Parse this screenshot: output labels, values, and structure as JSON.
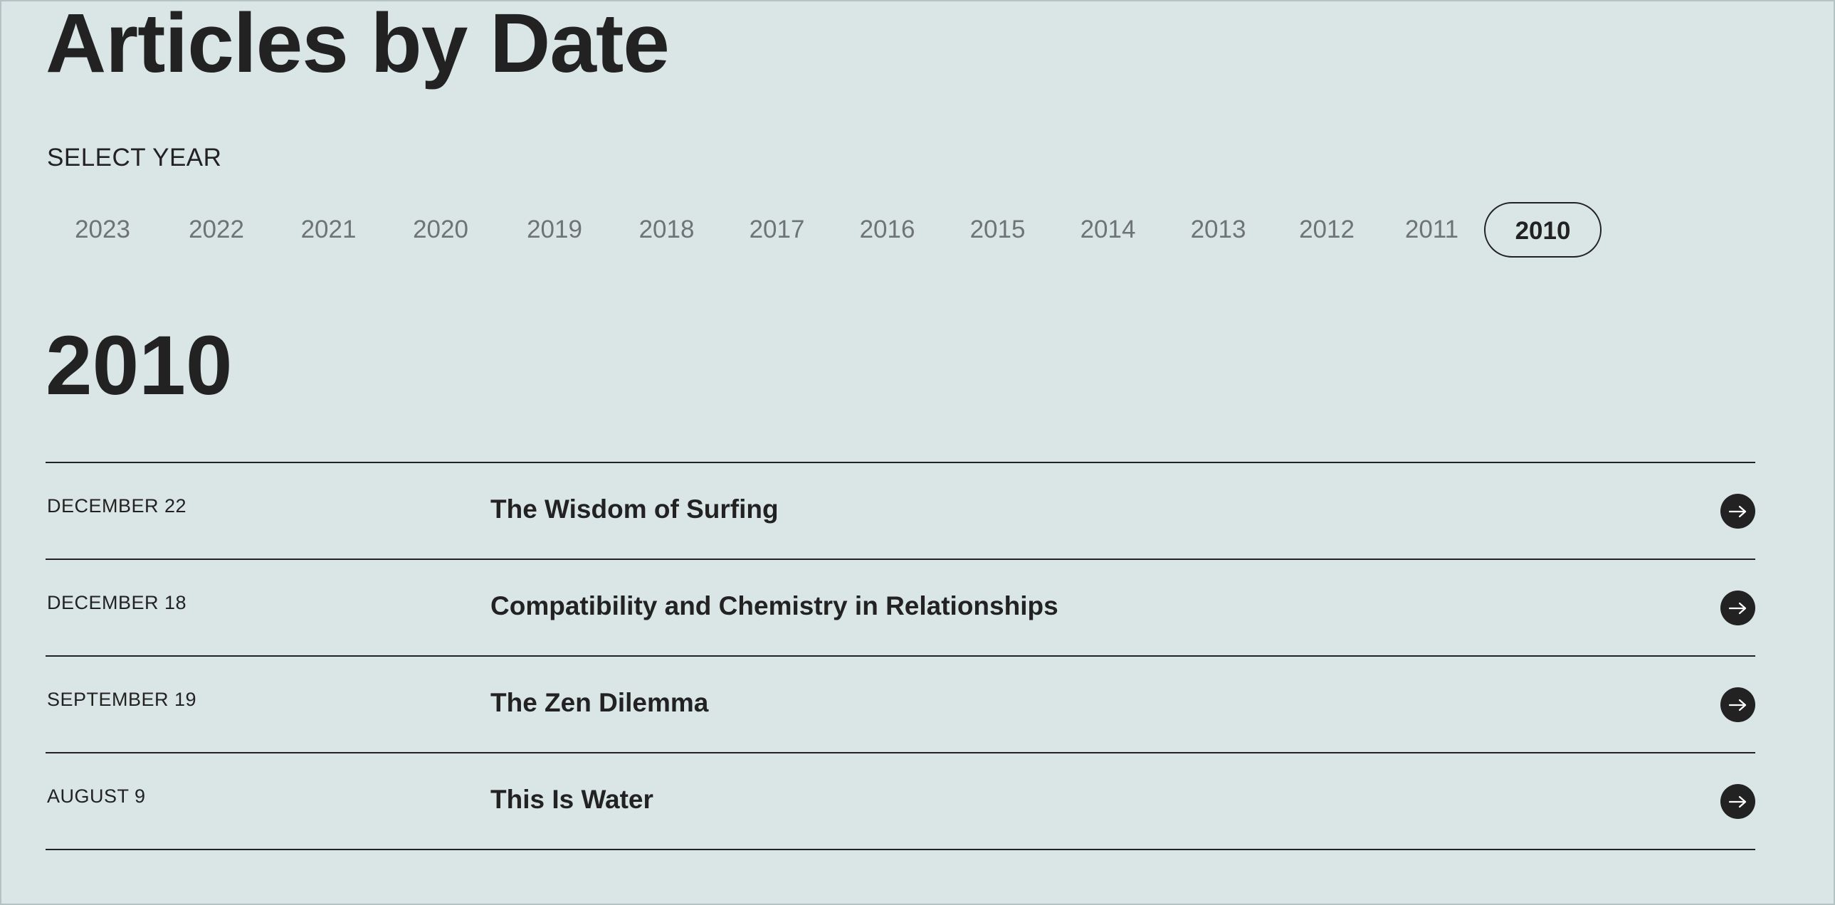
{
  "page": {
    "title": "Articles by Date"
  },
  "year_selector": {
    "label": "SELECT YEAR",
    "years": [
      "2023",
      "2022",
      "2021",
      "2020",
      "2019",
      "2018",
      "2017",
      "2016",
      "2015",
      "2014",
      "2013",
      "2012",
      "2011",
      "2010"
    ],
    "selected": "2010"
  },
  "section": {
    "year_heading": "2010"
  },
  "articles": [
    {
      "date": "DECEMBER 22",
      "title": "The Wisdom of Surfing"
    },
    {
      "date": "DECEMBER 18",
      "title": "Compatibility and Chemistry in Relationships"
    },
    {
      "date": "SEPTEMBER 19",
      "title": "The Zen Dilemma"
    },
    {
      "date": "AUGUST 9",
      "title": "This Is Water"
    }
  ],
  "icons": {
    "article_link": "arrow-right-icon"
  },
  "colors": {
    "background": "#dae6e6",
    "text": "#222222",
    "muted_year": "#6e7373"
  }
}
